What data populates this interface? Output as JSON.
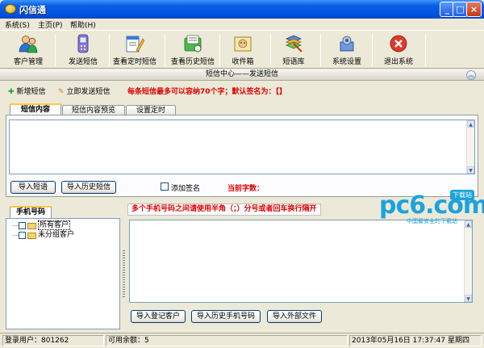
{
  "window": {
    "title": "闪信通"
  },
  "menu": [
    "系统(S)",
    "主页(P)",
    "帮助(H)"
  ],
  "toolbar": [
    {
      "label": "客户管理",
      "icon": "users-icon"
    },
    {
      "label": "发送短信",
      "icon": "mobile-phone-icon"
    },
    {
      "label": "查看定时短信",
      "icon": "scheduled-sms-icon"
    },
    {
      "label": "查看历史短信",
      "icon": "history-sms-icon"
    },
    {
      "label": "收件箱",
      "icon": "inbox-icon"
    },
    {
      "label": "短语库",
      "icon": "phrase-library-icon"
    },
    {
      "label": "系统设置",
      "icon": "settings-icon"
    },
    {
      "label": "退出系统",
      "icon": "exit-icon"
    }
  ],
  "section": {
    "title": "短信中心——发送短信"
  },
  "actions": {
    "add": "新增短信",
    "send_now": "立即发送短信",
    "warning": "每条短信最多可以容纳70个字；默认签名为：【】"
  },
  "tabs": [
    "短信内容",
    "短信内容预览",
    "设置定时"
  ],
  "compose": {
    "import_phrase": "导入短语",
    "import_history": "导入历史短信",
    "add_signature": "添加签名",
    "char_count_label": "当前字数："
  },
  "recipients": {
    "tab": "手机号码",
    "hint": "多个手机号码之间请使用半角（；）分号或者回车换行隔开",
    "tree": [
      "所有客户",
      "未分组客户"
    ],
    "import_registered": "导入登记客户",
    "import_history_phone": "导入历史手机号码",
    "import_external": "导入外部文件"
  },
  "status": {
    "user": "登录用户：801262",
    "balance": "可用余额：5",
    "datetime": "2013年05月16日  17:37:47  星期四"
  },
  "watermark": {
    "logo": "pc6.com",
    "badge": "下载站",
    "sub": "中国最安全的下载站"
  },
  "colors": {
    "title_bar": "#0054E3",
    "warning_text": "#E00000",
    "watermark": "#1BA3DE"
  }
}
